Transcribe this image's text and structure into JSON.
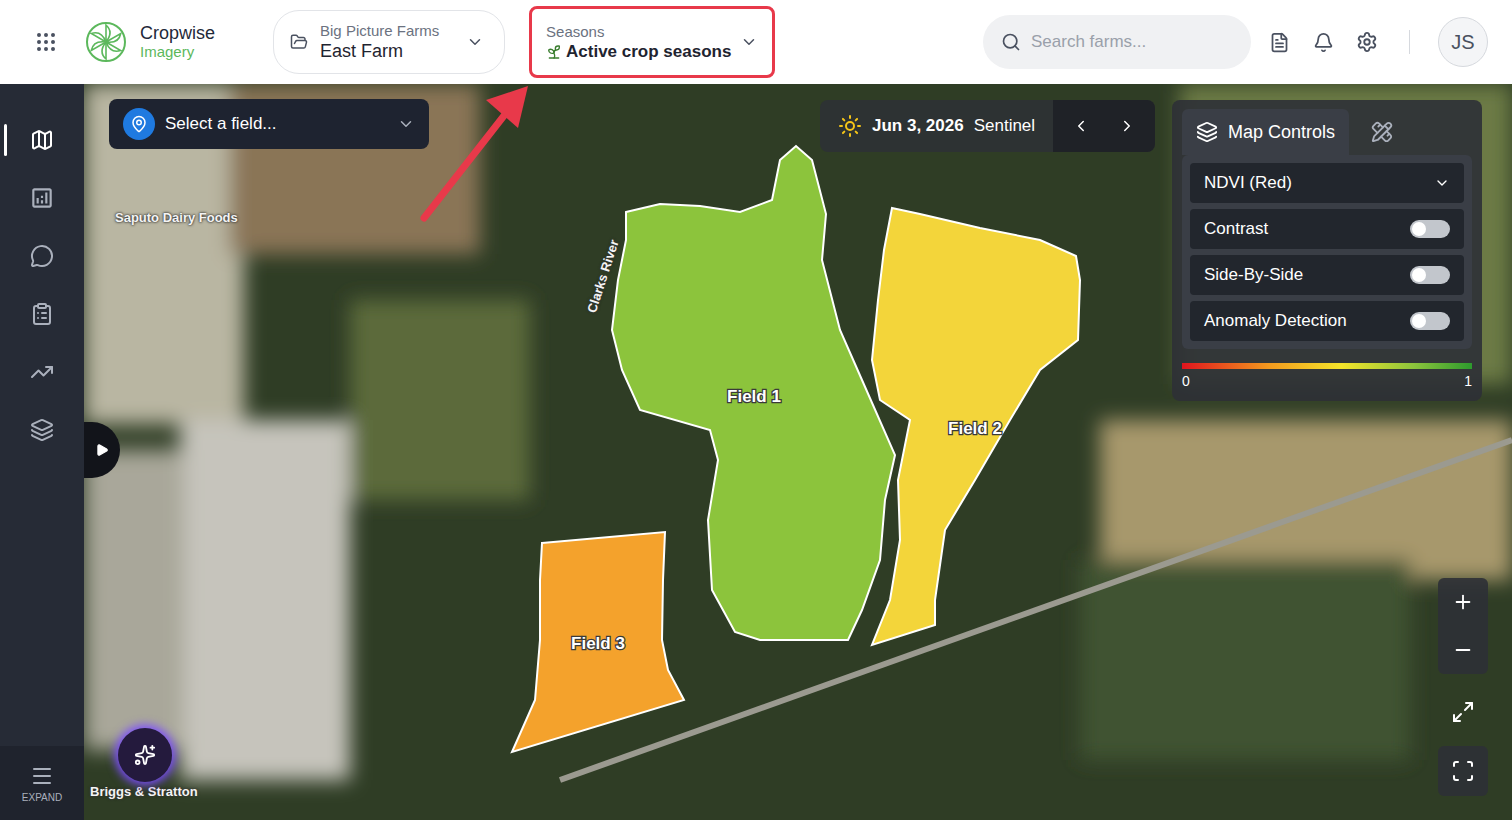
{
  "header": {
    "app": {
      "name": "Cropwise",
      "sub": "Imagery"
    },
    "farm": {
      "org": "Big Picture Farms",
      "name": "East Farm"
    },
    "seasons": {
      "label": "Seasons",
      "value": "Active crop seasons",
      "highlighted": true
    },
    "search": {
      "placeholder": "Search farms..."
    },
    "avatar": "JS"
  },
  "sidebar": {
    "items": [
      {
        "selected": true
      },
      {
        "selected": false
      },
      {
        "selected": false
      },
      {
        "selected": false
      },
      {
        "selected": false
      },
      {
        "selected": false
      }
    ],
    "expand": "EXPAND"
  },
  "map": {
    "fieldSelect": {
      "placeholder": "Select a field..."
    },
    "date": {
      "value": "Jun 3, 2026",
      "source": "Sentinel"
    },
    "labels": [
      "Saputo Dairy Foods",
      "Clarks River",
      "Briggs & Stratton"
    ],
    "fields": [
      {
        "name": "Field 1",
        "color": "#8cc43c"
      },
      {
        "name": "Field 2",
        "color": "#f3d53a"
      },
      {
        "name": "Field 3",
        "color": "#f4a22c"
      }
    ]
  },
  "controls": {
    "tabs": [
      {
        "label": "Map Controls",
        "selected": true
      },
      {
        "selected": false
      }
    ],
    "layer": "NDVI (Red)",
    "toggles": [
      {
        "label": "Contrast",
        "on": false
      },
      {
        "label": "Side-By-Side",
        "on": false
      },
      {
        "label": "Anomaly Detection",
        "on": false
      }
    ],
    "legend": {
      "min": "0",
      "max": "1"
    }
  }
}
